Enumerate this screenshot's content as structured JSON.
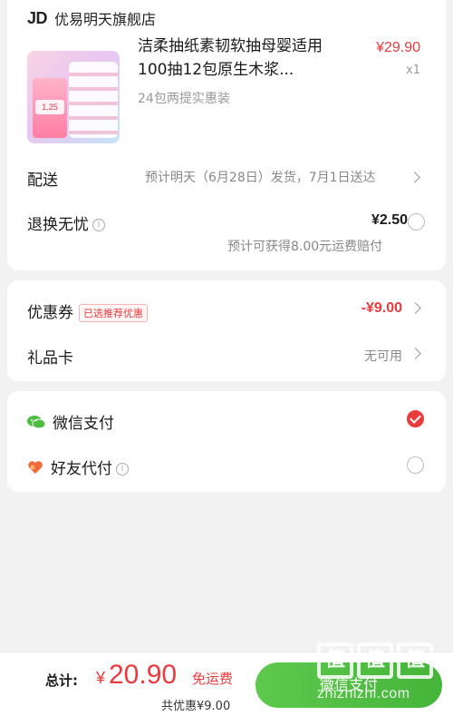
{
  "shop": {
    "logo": "JD",
    "name": "优易明天旗舰店"
  },
  "product": {
    "title": "洁柔抽纸素韧软抽母婴适用100抽12包原生木浆...",
    "price": "¥29.90",
    "quantity": "x1",
    "spec": "24包两提实惠装",
    "thumbnail_price": "1.25"
  },
  "delivery": {
    "label": "配送",
    "value": "预计明天（6月28日）发货，7月1日送达"
  },
  "return_service": {
    "label": "退换无忧",
    "price": "¥2.50",
    "note": "预计可获得8.00元运费赔付",
    "info_icon": "info-icon"
  },
  "coupon": {
    "label": "优惠券",
    "tag": "已选推荐优惠",
    "value": "-¥9.00"
  },
  "gift_card": {
    "label": "礼品卡",
    "value": "无可用"
  },
  "payment": {
    "wechat": {
      "label": "微信支付",
      "icon": "wechat-pay-icon",
      "selected": true
    },
    "friend": {
      "label": "好友代付",
      "icon": "heart-pay-icon",
      "selected": false
    }
  },
  "bottom": {
    "total_label": "总计:",
    "currency": "¥",
    "amount": "20.90",
    "free_shipping": "免运费",
    "saved": "共优惠¥9.00",
    "pay_button": "微信支付"
  },
  "watermark": {
    "chars": [
      "值",
      "值",
      "值"
    ],
    "text": "zhizhizhi.com"
  },
  "colors": {
    "accent_red": "#e93b3d",
    "wechat_green": "#4cbb3f",
    "background": "#f2f2f2"
  }
}
